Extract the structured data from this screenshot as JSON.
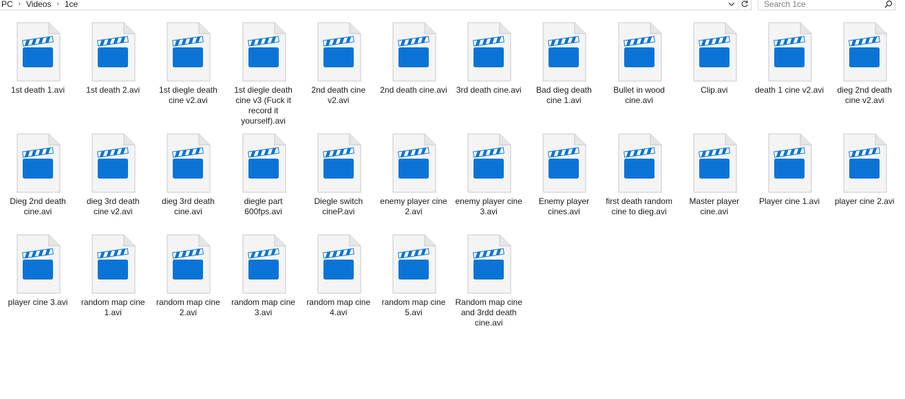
{
  "address": {
    "crumbs": [
      "PC",
      "Videos",
      "1ce"
    ]
  },
  "search": {
    "placeholder": "Search 1ce"
  },
  "colors": {
    "accent": "#0a74d6",
    "page": "#ffffff",
    "file_page": "#f4f4f4"
  },
  "icons": {
    "file": "video-file-icon",
    "dropdown": "chevron-down-icon",
    "refresh": "refresh-icon",
    "search": "search-icon"
  },
  "files": [
    {
      "name": "1st death 1.avi"
    },
    {
      "name": "1st death 2.avi"
    },
    {
      "name": "1st diegle death cine v2.avi"
    },
    {
      "name": "1st diegle death cine v3 (Fuck it record it yourself).avi"
    },
    {
      "name": "2nd death cine v2.avi"
    },
    {
      "name": "2nd death cine.avi"
    },
    {
      "name": "3rd death cine.avi"
    },
    {
      "name": "Bad dieg death cine 1.avi"
    },
    {
      "name": "Bullet in wood cine.avi"
    },
    {
      "name": "Clip.avi"
    },
    {
      "name": "death 1 cine v2.avi"
    },
    {
      "name": "dieg 2nd death cine v2.avi"
    },
    {
      "name": "Dieg 2nd death cine.avi"
    },
    {
      "name": "dieg 3rd death cine v2.avi"
    },
    {
      "name": "dieg 3rd death cine.avi"
    },
    {
      "name": "diegle part 600fps.avi"
    },
    {
      "name": "Diegle switch cineP.avi"
    },
    {
      "name": "enemy player cine 2.avi"
    },
    {
      "name": "enemy player cine 3.avi"
    },
    {
      "name": "Enemy player cines.avi"
    },
    {
      "name": "first death random cine to dieg.avi"
    },
    {
      "name": "Master player cine.avi"
    },
    {
      "name": "Player cine 1.avi"
    },
    {
      "name": "player cine 2.avi"
    },
    {
      "name": "player cine 3.avi"
    },
    {
      "name": "random map cine 1.avi"
    },
    {
      "name": "random map cine 2.avi"
    },
    {
      "name": "random map cine 3.avi"
    },
    {
      "name": "random map cine 4.avi"
    },
    {
      "name": "random map cine 5.avi"
    },
    {
      "name": "Random map cine and 3rdd death cine.avi"
    }
  ]
}
